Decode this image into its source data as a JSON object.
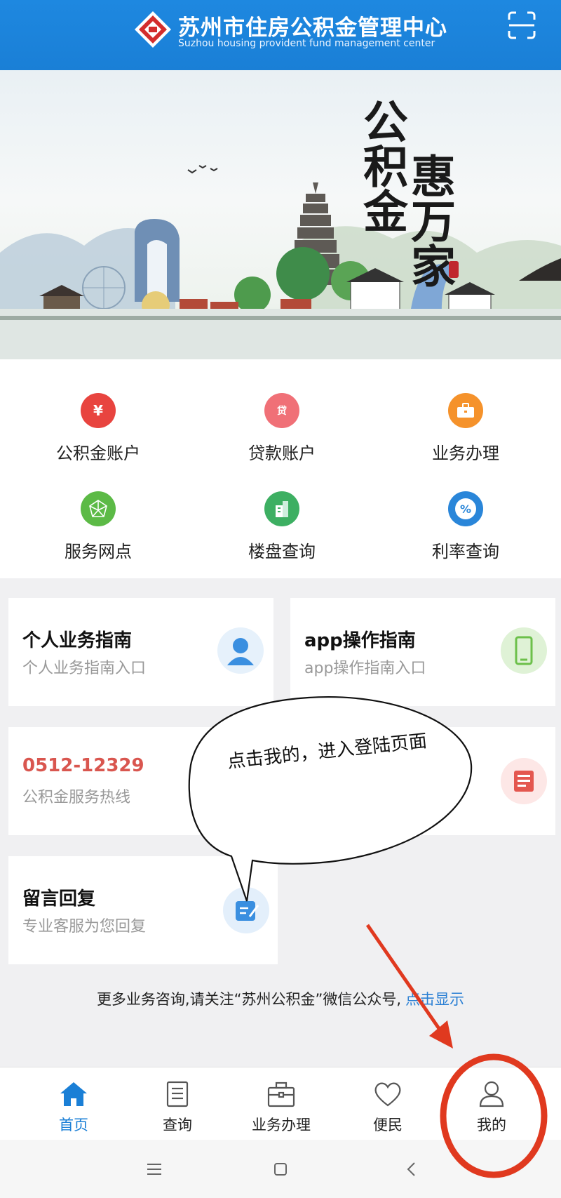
{
  "header": {
    "title": "苏州市住房公积金管理中心",
    "subtitle": "Suzhou housing provident fund management center",
    "logo_icon": "suzhou-hpf-logo-icon",
    "scan_icon": "scan-icon",
    "bg_color": "#1a7fd6"
  },
  "banner": {
    "slogan_line1": "公积金",
    "slogan_line2": "惠万家"
  },
  "menu": [
    {
      "label": "公积金账户",
      "icon": "money-bag-yen-icon",
      "color": "#e8443f",
      "glyph": "¥"
    },
    {
      "label": "贷款账户",
      "icon": "loan-bag-icon",
      "color": "#f07077",
      "glyph": "贷"
    },
    {
      "label": "业务办理",
      "icon": "briefcase-icon",
      "color": "#f5922b",
      "glyph": "▣"
    },
    {
      "label": "服务网点",
      "icon": "network-icon",
      "color": "#5cba46",
      "glyph": "✦"
    },
    {
      "label": "楼盘查询",
      "icon": "building-icon",
      "color": "#3daf62",
      "glyph": "▥"
    },
    {
      "label": "利率查询",
      "icon": "percent-icon",
      "color": "#2a86d9",
      "glyph": "%"
    }
  ],
  "cards": {
    "personal_guide": {
      "title": "个人业务指南",
      "sub": "个人业务指南入口"
    },
    "app_guide": {
      "title": "app操作指南",
      "sub": "app操作指南入口"
    },
    "hotline": {
      "title": "0512-12329",
      "sub": "公积金服务热线"
    },
    "message": {
      "title": "留言回复",
      "sub": "专业客服为您回复"
    }
  },
  "footer_note": {
    "text": "更多业务咨询,请关注“苏州公积金”微信公众号,",
    "link": "点击显示"
  },
  "tabbar": [
    {
      "label": "首页",
      "icon": "home-icon",
      "active": true
    },
    {
      "label": "查询",
      "icon": "document-list-icon",
      "active": false
    },
    {
      "label": "业务办理",
      "icon": "briefcase-outline-icon",
      "active": false
    },
    {
      "label": "便民",
      "icon": "heart-icon",
      "active": false
    },
    {
      "label": "我的",
      "icon": "user-icon",
      "active": false
    }
  ],
  "system_nav": [
    "menu-icon",
    "home-square-icon",
    "back-icon"
  ],
  "annotation": {
    "text": "点击我的，进入登陆页面",
    "color": "#e0391f"
  }
}
